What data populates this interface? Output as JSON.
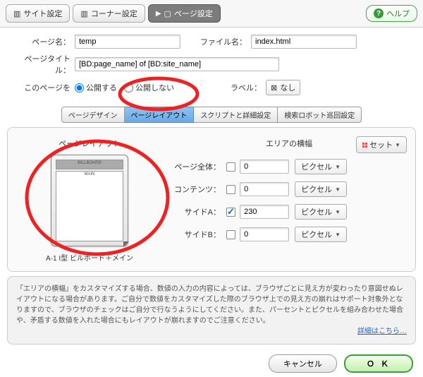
{
  "topbar": {
    "tab_site": "サイト設定",
    "tab_corner": "コーナー設定",
    "tab_page": "ページ設定",
    "help": "ヘルプ"
  },
  "form": {
    "page_name_lbl": "ページ名：",
    "page_name_val": "temp",
    "file_name_lbl": "ファイル名：",
    "file_name_val": "index.html",
    "page_title_lbl": "ページタイトル：",
    "page_title_val": "[BD:page_name] of [BD:site_name]",
    "publish_lbl": "このページを",
    "publish_yes": "公開する",
    "publish_no": "公開しない",
    "label_lbl": "ラベル：",
    "label_val": "なし"
  },
  "subtabs": {
    "design": "ページデザイン",
    "layout": "ページレイアウト",
    "script": "スクリプトと詳細設定",
    "robot": "検索ロボット巡回設定"
  },
  "set_button": "セット",
  "layout": {
    "heading": "ページレイアウト",
    "billboard": "BILLBOARD",
    "main": "MAIN",
    "caption": "A-1 I型 ビルボード＋メイン"
  },
  "widths": {
    "heading": "エリアの横幅",
    "rows": [
      {
        "label": "ページ全体：",
        "checked": false,
        "value": "0",
        "unit": "ピクセル"
      },
      {
        "label": "コンテンツ：",
        "checked": false,
        "value": "0",
        "unit": "ピクセル"
      },
      {
        "label": "サイドA：",
        "checked": true,
        "value": "230",
        "unit": "ピクセル"
      },
      {
        "label": "サイドB：",
        "checked": false,
        "value": "0",
        "unit": "ピクセル"
      }
    ]
  },
  "notice": {
    "text": "「エリアの横幅」をカスタマイズする場合、数値の入力の内容によっては、ブラウザごとに見え方が変わったり意図せぬレイアウトになる場合があります。ご自分で数値をカスタマイズした際のブラウザ上での見え方の崩れはサポート対象外となりますので、ブラウザのチェックはご自分で行なうようにしてください。また、パーセントとピクセルを組み合わせた場合や、矛盾する数値を入れた場合にもレイアウトが崩れますのでご注意ください。",
    "link": "詳細はこちら…"
  },
  "footer": {
    "cancel": "キャンセル",
    "ok": "Ｏ Ｋ"
  }
}
